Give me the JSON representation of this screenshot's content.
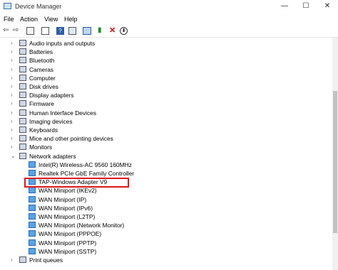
{
  "window": {
    "title": "Device Manager",
    "minimize": "—",
    "maximize": "☐",
    "close": "✕"
  },
  "menu": [
    "File",
    "Action",
    "View",
    "Help"
  ],
  "tree": {
    "categories": [
      "Audio inputs and outputs",
      "Batteries",
      "Bluetooth",
      "Cameras",
      "Computer",
      "Disk drives",
      "Display adapters",
      "Firmware",
      "Human Interface Devices",
      "Imaging devices",
      "Keyboards",
      "Mice and other pointing devices",
      "Monitors"
    ],
    "network_adapters": {
      "label": "Network adapters",
      "children": [
        "Intel(R) Wireless-AC 9560 160MHz",
        "Realtek PCIe GbE Family Controller",
        "TAP-Windows Adapter V9",
        "WAN Miniport (IKEv2)",
        "WAN Miniport (IP)",
        "WAN Miniport (IPv6)",
        "WAN Miniport (L2TP)",
        "WAN Miniport (Network Monitor)",
        "WAN Miniport (PPPOE)",
        "WAN Miniport (PPTP)",
        "WAN Miniport (SSTP)"
      ]
    },
    "partial_last": "Print queues"
  },
  "highlight_color": "#e0151b",
  "icons": {
    "toolbar": [
      "back-arrow-icon",
      "forward-arrow-icon",
      "properties-icon",
      "show-hidden-icon",
      "help-icon",
      "update-driver-icon",
      "scan-hardware-icon",
      "enable-device-icon",
      "uninstall-icon",
      "download-icon"
    ]
  }
}
